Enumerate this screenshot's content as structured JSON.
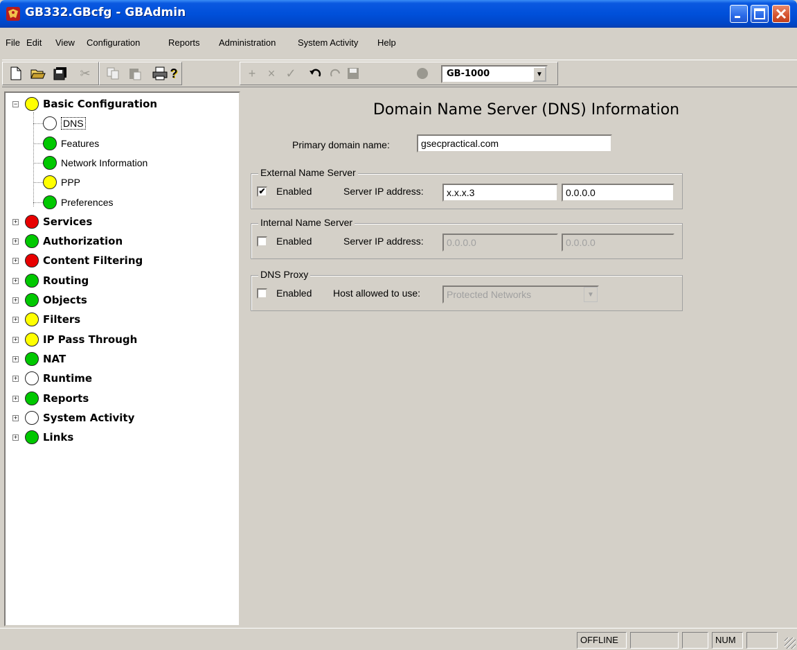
{
  "window": {
    "title": "GB332.GBcfg - GBAdmin"
  },
  "menu": [
    {
      "label": "File"
    },
    {
      "label": "Edit"
    },
    {
      "label": "View"
    },
    {
      "label": "Configuration"
    },
    {
      "label": "Reports"
    },
    {
      "label": "Administration"
    },
    {
      "label": "System Activity"
    },
    {
      "label": "Help"
    }
  ],
  "toolbar": {
    "device_select": "GB-1000"
  },
  "tree": {
    "items": [
      {
        "label": "Basic Configuration",
        "status": "yellow",
        "level": 0,
        "expanded": true
      },
      {
        "label": "DNS",
        "status": "white",
        "level": 1,
        "selected": true
      },
      {
        "label": "Features",
        "status": "green",
        "level": 1
      },
      {
        "label": "Network Information",
        "status": "green",
        "level": 1
      },
      {
        "label": "PPP",
        "status": "yellow",
        "level": 1
      },
      {
        "label": "Preferences",
        "status": "green",
        "level": 1
      },
      {
        "label": "Services",
        "status": "red",
        "level": 0
      },
      {
        "label": "Authorization",
        "status": "green",
        "level": 0
      },
      {
        "label": "Content Filtering",
        "status": "red",
        "level": 0
      },
      {
        "label": "Routing",
        "status": "green",
        "level": 0
      },
      {
        "label": "Objects",
        "status": "green",
        "level": 0
      },
      {
        "label": "Filters",
        "status": "yellow",
        "level": 0
      },
      {
        "label": "IP Pass Through",
        "status": "yellow",
        "level": 0
      },
      {
        "label": "NAT",
        "status": "green",
        "level": 0
      },
      {
        "label": "Runtime",
        "status": "white",
        "level": 0
      },
      {
        "label": "Reports",
        "status": "green",
        "level": 0
      },
      {
        "label": "System Activity",
        "status": "white",
        "level": 0
      },
      {
        "label": "Links",
        "status": "green",
        "level": 0
      }
    ]
  },
  "colors": {
    "green": "#00c800",
    "yellow": "#ffff00",
    "red": "#e80000",
    "white": "#ffffff"
  },
  "dns": {
    "heading": "Domain Name Server (DNS) Information",
    "primary_domain_label": "Primary domain name:",
    "primary_domain_value": "gsecpractical.com",
    "external": {
      "title": "External Name Server",
      "enabled_label": "Enabled",
      "enabled": true,
      "server_ip_label": "Server IP address:",
      "ip1": "x.x.x.3",
      "ip2": "0.0.0.0"
    },
    "internal": {
      "title": "Internal Name Server",
      "enabled_label": "Enabled",
      "enabled": false,
      "server_ip_label": "Server IP address:",
      "ip1": "0.0.0.0",
      "ip2": "0.0.0.0"
    },
    "proxy": {
      "title": "DNS Proxy",
      "enabled_label": "Enabled",
      "enabled": false,
      "host_label": "Host allowed to use:",
      "host_value": "Protected Networks"
    }
  },
  "status": {
    "mode": "OFFLINE",
    "num": "NUM"
  }
}
